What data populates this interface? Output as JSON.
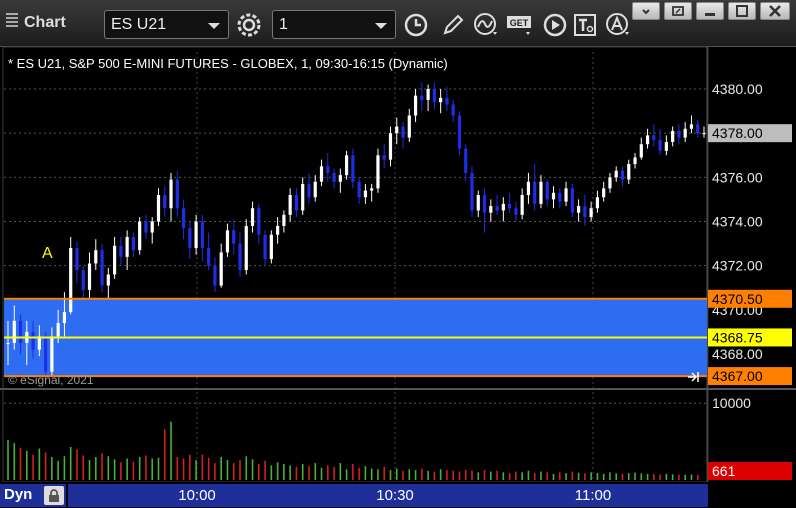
{
  "toolbar": {
    "title": "Chart",
    "symbol": "ES U21",
    "interval": "1",
    "get_label": "GET"
  },
  "chart": {
    "header": "* ES U21, S&P 500 E-MINI FUTURES - GLOBEX, 1, 09:30-16:15 (Dynamic)",
    "watermark": "© eSignal, 2021",
    "annotation": "A",
    "price_ticks": [
      "4380.00",
      "4378.00",
      "4376.00",
      "4374.00",
      "4372.00",
      "4370.00",
      "4368.00"
    ],
    "last_price": "4378.00",
    "upper_line": "4370.50",
    "mid_line": "4368.75",
    "lower_line": "4367.00",
    "volume_tick": "10000",
    "last_volume": "661",
    "time_labels": [
      "10:00",
      "10:30",
      "11:00"
    ],
    "status_label": "Dyn"
  },
  "colors": {
    "up": "#ffffff",
    "down": "#1e2ee6",
    "vol_up": "#4caf3c",
    "vol_down": "#d02020",
    "band": "#2e6cf2",
    "orange_line": "#ff7f00",
    "yellow_line": "#ffff00"
  },
  "chart_data": {
    "type": "candlestick",
    "symbol": "ES U21",
    "interval": "1 min",
    "ylim": [
      4366,
      4382
    ],
    "levels": {
      "upper": 4370.5,
      "middle": 4368.75,
      "lower": 4367.0
    },
    "ohlc": [
      [
        4368.5,
        4369.5,
        4367.5,
        4368.5
      ],
      [
        4368.5,
        4370.2,
        4368.2,
        4369.5
      ],
      [
        4369.5,
        4369.8,
        4368.0,
        4368.5
      ],
      [
        4368.5,
        4369.5,
        4367.5,
        4369.0
      ],
      [
        4369.0,
        4369.5,
        4367.8,
        4368.2
      ],
      [
        4368.2,
        4369.3,
        4367.9,
        4368.8
      ],
      [
        4368.8,
        4369.0,
        4366.8,
        4367.2
      ],
      [
        4367.2,
        4369.2,
        4367.0,
        4368.8
      ],
      [
        4368.8,
        4370.0,
        4368.5,
        4369.4
      ],
      [
        4369.4,
        4370.8,
        4368.8,
        4369.9
      ],
      [
        4369.9,
        4373.3,
        4369.8,
        4372.8
      ],
      [
        4372.8,
        4373.1,
        4371.2,
        4371.8
      ],
      [
        4371.8,
        4372.0,
        4370.5,
        4370.9
      ],
      [
        4370.9,
        4372.6,
        4370.5,
        4372.1
      ],
      [
        4372.1,
        4373.2,
        4371.8,
        4372.7
      ],
      [
        4372.7,
        4373.0,
        4370.8,
        4371.1
      ],
      [
        4371.1,
        4371.9,
        4370.5,
        4371.6
      ],
      [
        4371.6,
        4373.3,
        4371.4,
        4372.9
      ],
      [
        4372.9,
        4373.3,
        4372.0,
        4372.4
      ],
      [
        4372.4,
        4373.6,
        4371.8,
        4373.3
      ],
      [
        4373.3,
        4373.5,
        4372.4,
        4372.7
      ],
      [
        4372.7,
        4374.2,
        4372.5,
        4374.0
      ],
      [
        4374.0,
        4374.3,
        4373.2,
        4373.5
      ],
      [
        4373.5,
        4374.2,
        4373.0,
        4374.0
      ],
      [
        4374.0,
        4375.5,
        4373.8,
        4375.2
      ],
      [
        4375.2,
        4375.6,
        4374.2,
        4374.6
      ],
      [
        4374.6,
        4376.2,
        4374.0,
        4375.9
      ],
      [
        4375.9,
        4376.3,
        4374.2,
        4374.6
      ],
      [
        4374.6,
        4375.0,
        4373.2,
        4373.7
      ],
      [
        4373.7,
        4374.0,
        4372.3,
        4372.8
      ],
      [
        4372.8,
        4374.3,
        4372.5,
        4374.0
      ],
      [
        4374.0,
        4374.3,
        4372.2,
        4372.8
      ],
      [
        4372.8,
        4373.5,
        4371.8,
        4372.0
      ],
      [
        4372.0,
        4372.4,
        4370.8,
        4371.1
      ],
      [
        4371.1,
        4373.0,
        4371.0,
        4372.6
      ],
      [
        4372.6,
        4373.9,
        4372.4,
        4373.6
      ],
      [
        4373.6,
        4374.1,
        4372.5,
        4373.0
      ],
      [
        4373.0,
        4373.5,
        4371.5,
        4371.8
      ],
      [
        4371.8,
        4374.1,
        4371.6,
        4373.8
      ],
      [
        4373.8,
        4374.9,
        4373.5,
        4374.6
      ],
      [
        4374.6,
        4374.8,
        4373.0,
        4373.4
      ],
      [
        4373.4,
        4373.6,
        4372.0,
        4372.3
      ],
      [
        4372.3,
        4373.6,
        4372.1,
        4373.4
      ],
      [
        4373.4,
        4374.2,
        4373.0,
        4373.8
      ],
      [
        4373.8,
        4374.5,
        4373.5,
        4374.3
      ],
      [
        4374.3,
        4375.5,
        4374.0,
        4375.2
      ],
      [
        4375.2,
        4375.5,
        4374.2,
        4374.5
      ],
      [
        4374.5,
        4376.0,
        4374.3,
        4375.7
      ],
      [
        4375.7,
        4376.2,
        4374.8,
        4375.1
      ],
      [
        4375.1,
        4376.1,
        4374.9,
        4375.8
      ],
      [
        4375.8,
        4376.8,
        4375.6,
        4376.5
      ],
      [
        4376.5,
        4377.1,
        4375.8,
        4376.2
      ],
      [
        4376.2,
        4376.4,
        4375.5,
        4375.8
      ],
      [
        4375.8,
        4376.4,
        4375.3,
        4376.1
      ],
      [
        4376.1,
        4377.2,
        4375.9,
        4377.0
      ],
      [
        4377.0,
        4377.3,
        4375.5,
        4375.8
      ],
      [
        4375.8,
        4376.0,
        4374.8,
        4375.1
      ],
      [
        4375.1,
        4375.7,
        4374.8,
        4375.4
      ],
      [
        4375.4,
        4375.7,
        4374.9,
        4375.5
      ],
      [
        4375.5,
        4377.3,
        4375.3,
        4377.0
      ],
      [
        4377.0,
        4377.5,
        4376.4,
        4376.8
      ],
      [
        4376.8,
        4378.3,
        4376.5,
        4378.0
      ],
      [
        4378.0,
        4378.7,
        4377.5,
        4378.3
      ],
      [
        4378.3,
        4378.5,
        4377.3,
        4377.8
      ],
      [
        4377.8,
        4379.1,
        4377.6,
        4378.8
      ],
      [
        4378.8,
        4380.0,
        4378.5,
        4379.7
      ],
      [
        4379.7,
        4380.3,
        4379.0,
        4379.5
      ],
      [
        4379.5,
        4380.2,
        4379.0,
        4380.0
      ],
      [
        4380.0,
        4380.3,
        4379.1,
        4379.4
      ],
      [
        4379.4,
        4380.0,
        4378.9,
        4379.6
      ],
      [
        4379.6,
        4380.1,
        4379.0,
        4379.3
      ],
      [
        4379.3,
        4379.5,
        4378.5,
        4378.8
      ],
      [
        4378.8,
        4379.0,
        4377.0,
        4377.3
      ],
      [
        4377.3,
        4377.5,
        4375.8,
        4376.2
      ],
      [
        4376.2,
        4376.5,
        4374.2,
        4374.5
      ],
      [
        4374.5,
        4375.4,
        4374.2,
        4375.2
      ],
      [
        4375.2,
        4375.5,
        4373.5,
        4374.4
      ],
      [
        4374.4,
        4375.0,
        4374.0,
        4374.7
      ],
      [
        4374.7,
        4375.2,
        4374.3,
        4374.5
      ],
      [
        4374.5,
        4375.1,
        4374.0,
        4374.8
      ],
      [
        4374.8,
        4375.3,
        4374.4,
        4374.6
      ],
      [
        4374.6,
        4374.9,
        4374.0,
        4374.3
      ],
      [
        4374.3,
        4375.5,
        4374.1,
        4375.2
      ],
      [
        4375.2,
        4376.2,
        4374.8,
        4375.8
      ],
      [
        4375.8,
        4376.6,
        4374.5,
        4374.8
      ],
      [
        4374.8,
        4376.1,
        4374.6,
        4375.8
      ],
      [
        4375.8,
        4375.9,
        4374.7,
        4375.0
      ],
      [
        4375.0,
        4375.6,
        4374.6,
        4375.3
      ],
      [
        4375.3,
        4375.5,
        4374.6,
        4374.9
      ],
      [
        4374.9,
        4375.8,
        4374.7,
        4375.5
      ],
      [
        4375.5,
        4375.7,
        4374.2,
        4374.4
      ],
      [
        4374.4,
        4375.0,
        4374.0,
        4374.7
      ],
      [
        4374.7,
        4375.2,
        4373.8,
        4374.2
      ],
      [
        4374.2,
        4374.9,
        4374.0,
        4374.6
      ],
      [
        4374.6,
        4375.4,
        4374.4,
        4375.1
      ],
      [
        4375.1,
        4375.8,
        4374.9,
        4375.5
      ],
      [
        4375.5,
        4376.2,
        4375.3,
        4376.0
      ],
      [
        4376.0,
        4376.5,
        4375.8,
        4376.3
      ],
      [
        4376.3,
        4376.5,
        4375.6,
        4375.9
      ],
      [
        4375.9,
        4376.8,
        4375.7,
        4376.6
      ],
      [
        4376.6,
        4377.1,
        4376.4,
        4376.9
      ],
      [
        4376.9,
        4377.8,
        4376.8,
        4377.5
      ],
      [
        4377.5,
        4378.2,
        4377.3,
        4377.9
      ],
      [
        4377.9,
        4378.4,
        4377.4,
        4377.7
      ],
      [
        4377.7,
        4378.2,
        4377.0,
        4377.2
      ],
      [
        4377.2,
        4377.9,
        4377.0,
        4377.6
      ],
      [
        4377.6,
        4378.3,
        4377.4,
        4378.1
      ],
      [
        4378.1,
        4378.4,
        4377.5,
        4377.8
      ],
      [
        4377.8,
        4378.5,
        4377.6,
        4378.2
      ],
      [
        4378.2,
        4378.8,
        4378.0,
        4378.4
      ],
      [
        4378.4,
        4378.6,
        4377.8,
        4378.0
      ],
      [
        4378.0,
        4378.3,
        4377.8,
        4378.0
      ]
    ],
    "volume": {
      "ylim": [
        0,
        11200
      ],
      "values": [
        5200,
        4800,
        4200,
        3800,
        3300,
        4100,
        3600,
        3000,
        2500,
        3100,
        4300,
        4000,
        3200,
        2600,
        3000,
        3500,
        3100,
        2700,
        2300,
        2800,
        2400,
        3000,
        3200,
        2800,
        2900,
        6600,
        7600,
        3000,
        2800,
        3300,
        2600,
        3300,
        2900,
        2200,
        3000,
        2600,
        2200,
        2600,
        3100,
        2700,
        2100,
        2500,
        1900,
        2300,
        2100,
        1900,
        1700,
        2100,
        1800,
        2200,
        1600,
        1900,
        1700,
        2200,
        1400,
        2100,
        1600,
        1800,
        1500,
        1400,
        1700,
        1300,
        1500,
        1200,
        1400,
        1300,
        1500,
        1200,
        1100,
        1400,
        1300,
        1200,
        1100,
        1300,
        1200,
        1000,
        1300,
        1100,
        1200,
        1000,
        900,
        1100,
        1000,
        1200,
        900,
        1100,
        1000,
        800,
        1000,
        900,
        1100,
        950,
        850,
        1000,
        900,
        800,
        1000,
        850,
        800,
        900,
        950,
        850,
        800,
        780,
        720,
        800,
        750,
        700,
        680,
        720,
        661
      ]
    }
  }
}
